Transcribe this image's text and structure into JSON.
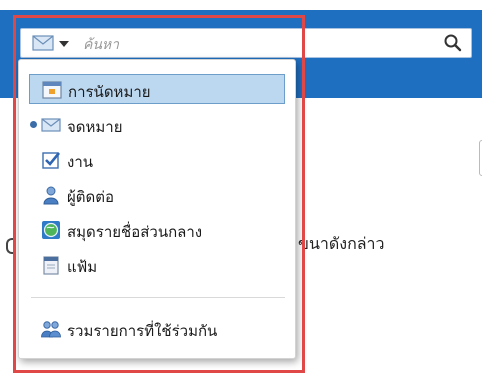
{
  "search": {
    "placeholder": "ค้นหา"
  },
  "menu": {
    "items": [
      {
        "label": "การนัดหมาย",
        "icon": "calendar-icon",
        "selected": true
      },
      {
        "label": "จดหมาย",
        "icon": "mail-icon",
        "current": true
      },
      {
        "label": "งาน",
        "icon": "task-checkbox-icon"
      },
      {
        "label": "ผู้ติดต่อ",
        "icon": "contact-person-icon"
      },
      {
        "label": "สมุดรายชื่อส่วนกลาง",
        "icon": "global-address-book-icon"
      },
      {
        "label": "แฟ้ม",
        "icon": "folder-icon"
      }
    ],
    "shared": {
      "label": "รวมรายการที่ใช้ร่วมกัน",
      "icon": "shared-people-icon"
    }
  },
  "background": {
    "text": "ขนาดังกล่าว"
  },
  "colors": {
    "accent": "#1f6fc1",
    "highlight": "#e04848",
    "selection": "#bcd8f1"
  }
}
